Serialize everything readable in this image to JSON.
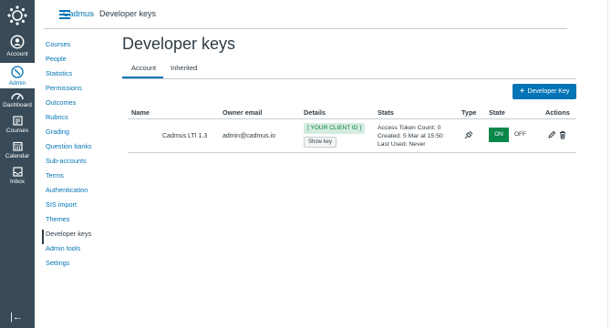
{
  "global_nav": {
    "items": [
      {
        "label": "Account",
        "icon": "user-avatar-icon"
      },
      {
        "label": "Admin",
        "icon": "shield-icon",
        "active": true
      },
      {
        "label": "Dashboard",
        "icon": "speedometer-icon"
      },
      {
        "label": "Courses",
        "icon": "book-icon"
      },
      {
        "label": "Calendar",
        "icon": "calendar-icon"
      },
      {
        "label": "Inbox",
        "icon": "inbox-icon"
      }
    ],
    "collapse_glyph": "|←"
  },
  "breadcrumb": {
    "account": "Cadmus",
    "separator": "›",
    "current": "Developer keys"
  },
  "course_nav": {
    "items": [
      "Courses",
      "People",
      "Statistics",
      "Permissions",
      "Outcomes",
      "Rubrics",
      "Grading",
      "Question banks",
      "Sub-accounts",
      "Terms",
      "Authentication",
      "SIS import",
      "Themes",
      "Developer keys",
      "Admin tools",
      "Settings"
    ],
    "active": "Developer keys"
  },
  "page": {
    "title": "Developer keys",
    "tabs": {
      "account": "Account",
      "inherited": "Inherited"
    },
    "add_button": "Developer Key"
  },
  "table": {
    "headers": {
      "name": "Name",
      "owner": "Owner email",
      "details": "Details",
      "stats": "Stats",
      "type": "Type",
      "state": "State",
      "actions": "Actions"
    },
    "rows": [
      {
        "name": "Cadmus LTI 1.3",
        "owner": "admin@cadmus.io",
        "client_id": "[ YOUR CLIENT ID ]",
        "show_key": "Show key",
        "stats": [
          "Access Token Count: 0",
          "Created: 5 Mar at 15:50",
          "Last Used: Never"
        ],
        "type_icon": "plug-icon",
        "state_on": "ON",
        "state_off": "OFF"
      }
    ]
  },
  "colors": {
    "nav_bg": "#394b58",
    "link": "#0374b5",
    "on_green": "#0b874b",
    "client_id_bg": "#d5ebe0"
  }
}
